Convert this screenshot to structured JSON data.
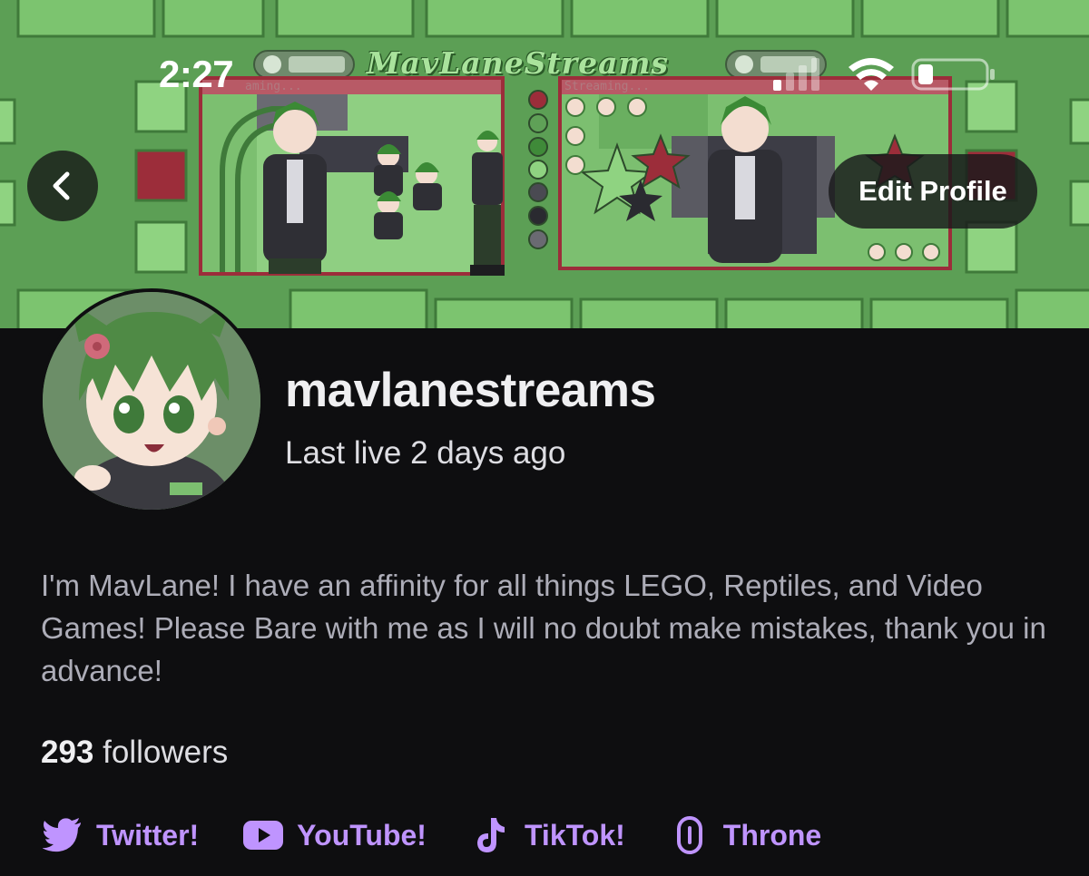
{
  "status_bar": {
    "time": "2:27"
  },
  "banner": {
    "title": "MavLaneStreams",
    "left_window_label": "aming...",
    "right_window_label": "Streaming..."
  },
  "header": {
    "edit_profile_label": "Edit Profile"
  },
  "profile": {
    "username": "mavlanestreams",
    "last_live": "Last live 2 days ago",
    "bio": "I'm MavLane! I have an affinity for all things LEGO, Reptiles, and Video Games! Please Bare with me as I will no doubt make mistakes, thank you in advance!",
    "followers_count": "293",
    "followers_label": "followers"
  },
  "social_links": [
    {
      "label": "Twitter!",
      "icon": "twitter-bird-icon"
    },
    {
      "label": "YouTube!",
      "icon": "youtube-play-icon"
    },
    {
      "label": "TikTok!",
      "icon": "tiktok-note-icon"
    },
    {
      "label": "Throne",
      "icon": "throne-chain-icon"
    }
  ],
  "colors": {
    "background": "#0e0e10",
    "accent": "#bf94ff",
    "banner_green": "#5fa157"
  }
}
